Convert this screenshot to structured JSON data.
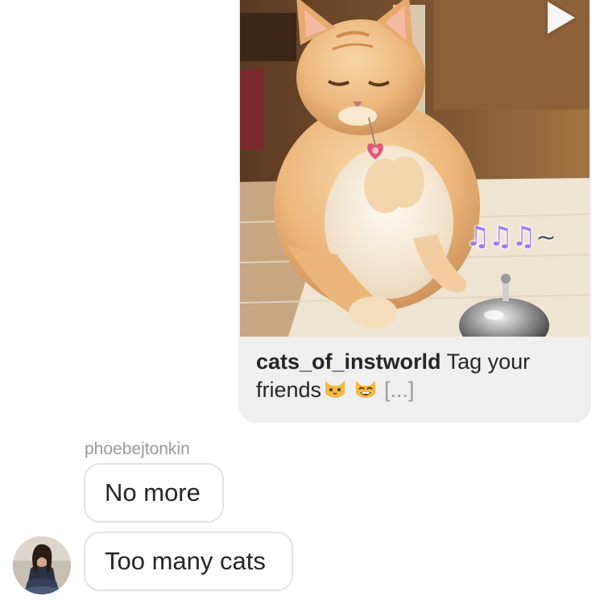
{
  "shared_post": {
    "username": "cats_of_instworld",
    "caption_line1": " Tag your",
    "caption_line2": "friends",
    "more": "[...]",
    "overlay_notes": "♫♫♫",
    "overlay_tilde": "~",
    "media_icon": "play-icon",
    "emojis": [
      "cat-face-emoji",
      "grinning-cat-emoji"
    ]
  },
  "conversation": {
    "sender": "phoebejtonkin",
    "messages": [
      {
        "text": "No more"
      },
      {
        "text": "Too many cats"
      }
    ]
  },
  "colors": {
    "bubble_bg": "#efefef",
    "outgoing_border": "#e3e3e3",
    "text": "#262626",
    "muted": "#999999",
    "notes": "#9b7df0"
  }
}
